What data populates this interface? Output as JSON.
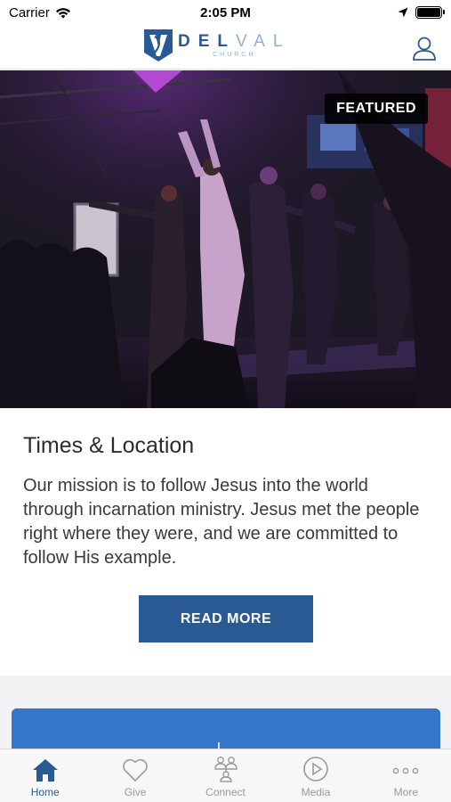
{
  "status_bar": {
    "carrier": "Carrier",
    "time": "2:05 PM"
  },
  "header": {
    "logo_letter": "V",
    "logo_word_bold": "DEL",
    "logo_word_thin": "VAL",
    "logo_sub": "CHURCH"
  },
  "hero": {
    "badge": "FEATURED"
  },
  "card": {
    "title": "Times & Location",
    "body": "Our mission is to follow Jesus into the world through incarnation ministry. Jesus met the people right where they were, and we are committed to follow His example.",
    "button_label": "READ MORE"
  },
  "tabs": [
    {
      "label": "Home",
      "icon": "home-icon",
      "active": true
    },
    {
      "label": "Give",
      "icon": "heart-icon",
      "active": false
    },
    {
      "label": "Connect",
      "icon": "people-icon",
      "active": false
    },
    {
      "label": "Media",
      "icon": "play-icon",
      "active": false
    },
    {
      "label": "More",
      "icon": "more-icon",
      "active": false
    }
  ],
  "colors": {
    "accent": "#2a5a94",
    "tab_inactive": "#9a9a9a"
  }
}
